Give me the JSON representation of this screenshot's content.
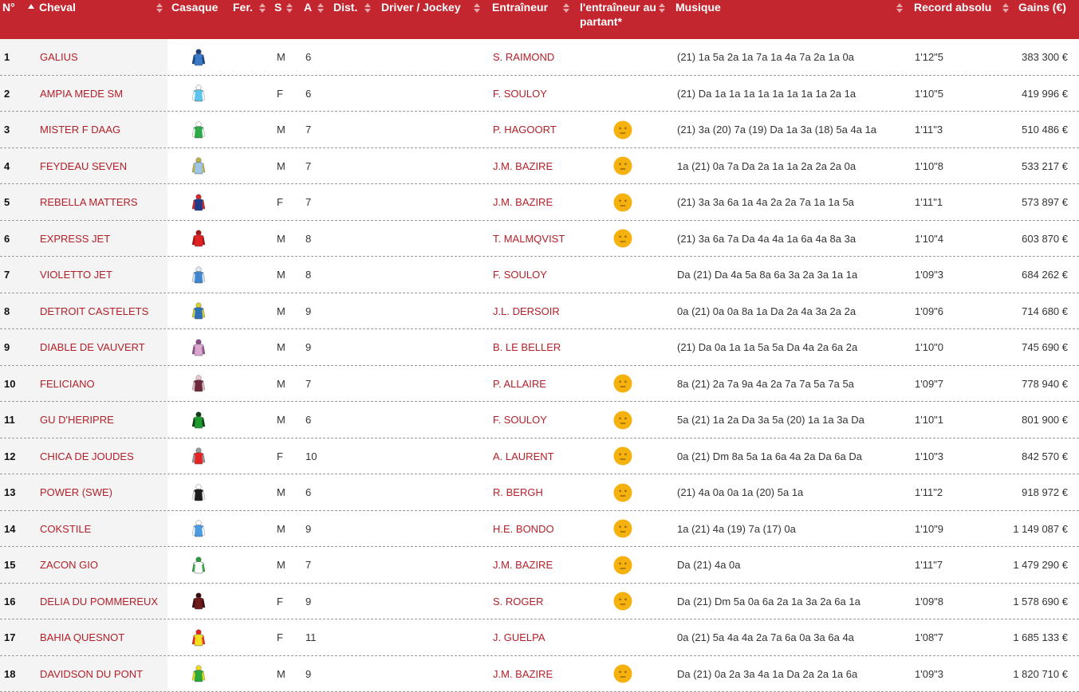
{
  "colors": {
    "header_bg": "#c3262f",
    "link": "#b3202a"
  },
  "headers": {
    "num": "N°",
    "cheval": "Cheval",
    "casaque": "Casaque",
    "fer": "Fer.",
    "sexe": "S",
    "age": "A",
    "dist": "Dist.",
    "driver": "Driver / Jockey",
    "entraineur": "Entraîneur",
    "entraineur_partant_l1": "l'entraîneur au",
    "entraineur_partant_l2": "partant*",
    "musique": "Musique",
    "record": "Record absolu",
    "gains": "Gains (€)"
  },
  "rows": [
    {
      "num": "1",
      "name": "GALIUS",
      "casaque": {
        "body": "#3a7bc8",
        "trim": "#1d3f7a"
      },
      "sex": "M",
      "age": "6",
      "trainer": "S. RAIMOND",
      "mood": false,
      "musique": "(21) 1a 5a 2a 1a 7a 1a 4a 7a 2a 1a 0a",
      "record": "1'12\"5",
      "gains": "383 300 €"
    },
    {
      "num": "2",
      "name": "AMPIA MEDE SM",
      "casaque": {
        "body": "#5ec3ea",
        "trim": "#ffffff"
      },
      "sex": "F",
      "age": "6",
      "trainer": "F. SOULOY",
      "mood": false,
      "musique": "(21) Da 1a 1a 1a 1a 1a 1a 1a 1a 2a 1a",
      "record": "1'10\"5",
      "gains": "419 996 €"
    },
    {
      "num": "3",
      "name": "MISTER F DAAG",
      "casaque": {
        "body": "#2fa84a",
        "trim": "#ffffff"
      },
      "sex": "M",
      "age": "7",
      "trainer": "P. HAGOORT",
      "mood": true,
      "musique": "(21) 3a (20) 7a (19) Da 1a 3a (18) 5a 4a 1a",
      "record": "1'11\"3",
      "gains": "510 486 €"
    },
    {
      "num": "4",
      "name": "FEYDEAU SEVEN",
      "casaque": {
        "body": "#9fc4e6",
        "trim": "#b7b34a"
      },
      "sex": "M",
      "age": "7",
      "trainer": "J.M. BAZIRE",
      "mood": true,
      "musique": "1a (21) 0a 7a Da 2a 1a 1a 2a 2a 2a 0a",
      "record": "1'10\"8",
      "gains": "533 217 €"
    },
    {
      "num": "5",
      "name": "REBELLA MATTERS",
      "casaque": {
        "body": "#1f3a8a",
        "trim": "#d22a2a"
      },
      "sex": "F",
      "age": "7",
      "trainer": "J.M. BAZIRE",
      "mood": true,
      "musique": "(21) 3a 3a 6a 1a 4a 2a 2a 7a 1a 1a 5a",
      "record": "1'11\"1",
      "gains": "573 897 €"
    },
    {
      "num": "6",
      "name": "EXPRESS JET",
      "casaque": {
        "body": "#e02222",
        "trim": "#a81515"
      },
      "sex": "M",
      "age": "8",
      "trainer": "T. MALMQVIST",
      "mood": true,
      "musique": "(21) 3a 6a 7a Da 4a 4a 1a 6a 4a 8a 3a",
      "record": "1'10\"4",
      "gains": "603 870 €"
    },
    {
      "num": "7",
      "name": "VIOLETTO JET",
      "casaque": {
        "body": "#3f86cc",
        "trim": "#dfe8f3"
      },
      "sex": "M",
      "age": "8",
      "trainer": "F. SOULOY",
      "mood": false,
      "musique": "Da (21) Da 4a 5a 8a 6a 3a 2a 3a 1a 1a",
      "record": "1'09\"3",
      "gains": "684 262 €"
    },
    {
      "num": "8",
      "name": "DETROIT CASTELETS",
      "casaque": {
        "body": "#2d6fb5",
        "trim": "#d7d23a"
      },
      "sex": "M",
      "age": "9",
      "trainer": "J.L. DERSOIR",
      "mood": false,
      "musique": "0a (21) 0a 0a 8a 1a Da 2a 4a 3a 2a 2a",
      "record": "1'09\"6",
      "gains": "714 680 €"
    },
    {
      "num": "9",
      "name": "DIABLE DE VAUVERT",
      "casaque": {
        "body": "#d9a6cf",
        "trim": "#8a4c83"
      },
      "sex": "M",
      "age": "9",
      "trainer": "B. LE BELLER",
      "mood": false,
      "musique": "(21) Da 0a 1a 1a 5a 5a Da 4a 2a 6a 2a",
      "record": "1'10\"0",
      "gains": "745 690 €"
    },
    {
      "num": "10",
      "name": "FELICIANO",
      "casaque": {
        "body": "#6b2a3a",
        "trim": "#e8c8cf"
      },
      "sex": "M",
      "age": "7",
      "trainer": "P. ALLAIRE",
      "mood": true,
      "musique": "8a (21) 2a 7a 9a 4a 2a 7a 7a 5a 7a 5a",
      "record": "1'09\"7",
      "gains": "778 940 €"
    },
    {
      "num": "11",
      "name": "GU D'HERIPRE",
      "casaque": {
        "body": "#1f9a2e",
        "trim": "#0d3d14"
      },
      "sex": "M",
      "age": "6",
      "trainer": "F. SOULOY",
      "mood": true,
      "musique": "5a (21) 1a 2a Da 3a 5a (20) 1a 1a 3a Da",
      "record": "1'10\"1",
      "gains": "801 900 €"
    },
    {
      "num": "12",
      "name": "CHICA DE JOUDES",
      "casaque": {
        "body": "#e42424",
        "trim": "#9a9a9a"
      },
      "sex": "F",
      "age": "10",
      "trainer": "A. LAURENT",
      "mood": true,
      "musique": "0a (21) Dm 8a 5a 1a 6a 4a 2a Da 6a Da",
      "record": "1'10\"3",
      "gains": "842 570 €"
    },
    {
      "num": "13",
      "name": "POWER (SWE)",
      "casaque": {
        "body": "#1c1c1c",
        "trim": "#ffffff"
      },
      "sex": "M",
      "age": "6",
      "trainer": "R. BERGH",
      "mood": true,
      "musique": "(21) 4a 0a 0a 1a (20) 5a 1a",
      "record": "1'11\"2",
      "gains": "918 972 €"
    },
    {
      "num": "14",
      "name": "COKSTILE",
      "casaque": {
        "body": "#4c9be0",
        "trim": "#ffffff"
      },
      "sex": "M",
      "age": "9",
      "trainer": "H.E. BONDO",
      "mood": true,
      "musique": "1a (21) 4a (19) 7a (17) 0a",
      "record": "1'10\"9",
      "gains": "1 149 087 €"
    },
    {
      "num": "15",
      "name": "ZACON GIO",
      "casaque": {
        "body": "#ffffff",
        "trim": "#2c9a3a"
      },
      "sex": "M",
      "age": "7",
      "trainer": "J.M. BAZIRE",
      "mood": true,
      "musique": "Da (21) 4a 0a",
      "record": "1'11\"7",
      "gains": "1 479 290 €"
    },
    {
      "num": "16",
      "name": "DELIA DU POMMEREUX",
      "casaque": {
        "body": "#6e1a1a",
        "trim": "#3a0c0c"
      },
      "sex": "F",
      "age": "9",
      "trainer": "S. ROGER",
      "mood": true,
      "musique": "Da (21) Dm 5a 0a 6a 2a 1a 3a 2a 6a 1a",
      "record": "1'09\"8",
      "gains": "1 578 690 €"
    },
    {
      "num": "17",
      "name": "BAHIA QUESNOT",
      "casaque": {
        "body": "#f2dd1e",
        "trim": "#e02222"
      },
      "sex": "F",
      "age": "11",
      "trainer": "J. GUELPA",
      "mood": false,
      "musique": "0a (21) 5a 4a 4a 2a 7a 6a 0a 3a 6a 4a",
      "record": "1'08\"7",
      "gains": "1 685 133 €"
    },
    {
      "num": "18",
      "name": "DAVIDSON DU PONT",
      "casaque": {
        "body": "#2aa83a",
        "trim": "#f2dd1e"
      },
      "sex": "M",
      "age": "9",
      "trainer": "J.M. BAZIRE",
      "mood": true,
      "musique": "Da (21) 0a 2a 3a 4a 1a Da 2a 2a 1a 6a",
      "record": "1'09\"3",
      "gains": "1 820 710 €"
    }
  ]
}
